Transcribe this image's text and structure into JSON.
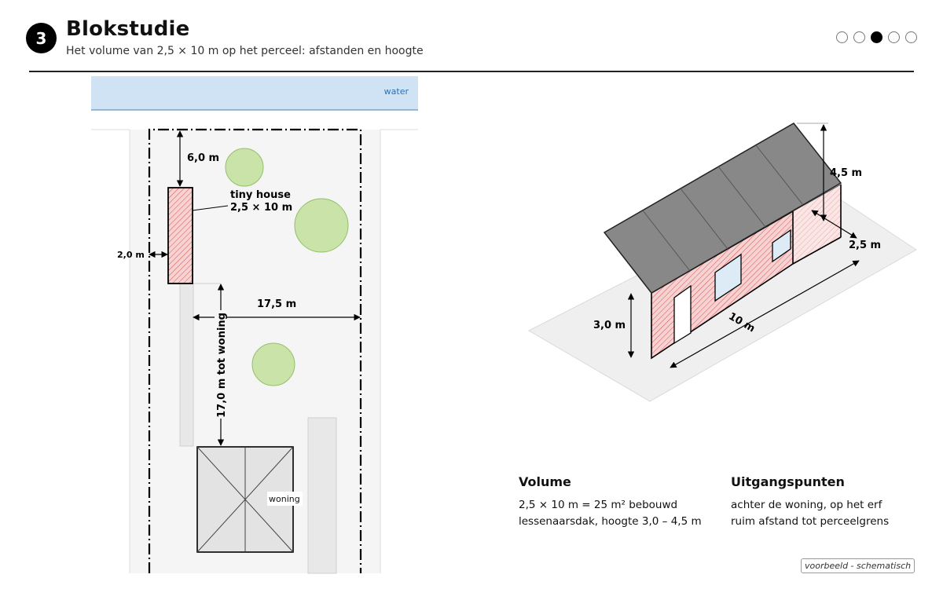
{
  "header": {
    "step": "3",
    "title": "Blokstudie",
    "subtitle": "Het volume van 2,5 × 10 m op het perceel: afstanden en hoogte",
    "progress": {
      "total": 5,
      "active_index": 2
    }
  },
  "plan": {
    "water_label": "water",
    "tiny_house_label": "tiny house",
    "tiny_house_size": "2,5 × 10 m",
    "dim_rear": "6,0 m",
    "dim_side": "2,0 m",
    "dim_width_to_boundary": "17,5 m",
    "dim_to_house": "17,0 m tot woning",
    "woning_label": "woning"
  },
  "iso": {
    "dim_height_ridge": "4,5 m",
    "dim_depth": "2,5 m",
    "dim_height_eave": "3,0 m",
    "dim_length": "10 m"
  },
  "info": {
    "volume": {
      "title": "Volume",
      "lines": [
        "2,5 × 10 m = 25 m² bebouwd",
        "lessenaarsdak, hoogte 3,0 – 4,5 m"
      ]
    },
    "uitgangspunten": {
      "title": "Uitgangspunten",
      "lines": [
        "achter de woning, op het erf",
        "ruim afstand tot perceelgrens"
      ]
    }
  },
  "footnote": "voorbeeld - schematisch",
  "colors": {
    "accent_hatch": "#d9534f",
    "tiny_house_fill": "#f6cfcf",
    "water": "#cfe3f5",
    "tree": "#c9e3a9",
    "roof": "#888888"
  }
}
